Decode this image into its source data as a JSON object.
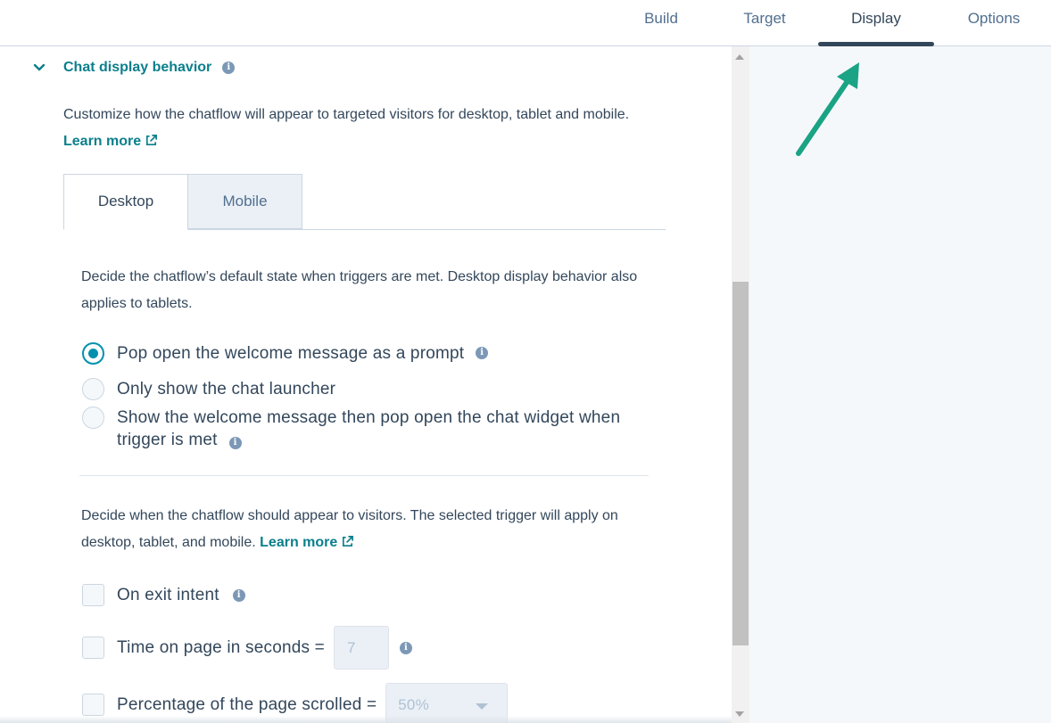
{
  "top_nav": {
    "tabs": [
      {
        "label": "Build"
      },
      {
        "label": "Target"
      },
      {
        "label": "Display"
      },
      {
        "label": "Options"
      }
    ]
  },
  "section": {
    "title": "Chat display behavior",
    "description": "Customize how the chatflow will appear to targeted visitors for desktop, tablet and mobile.",
    "learn_more": "Learn more"
  },
  "device_tabs": {
    "desktop": "Desktop",
    "mobile": "Mobile"
  },
  "default_state": {
    "description": "Decide the chatflow’s default state when triggers are met. Desktop display behavior also applies to tablets.",
    "options": [
      {
        "label": "Pop open the welcome message as a prompt",
        "checked": true
      },
      {
        "label": "Only show the chat launcher",
        "checked": false
      },
      {
        "label": "Show the welcome message then pop open the chat widget when trigger is met",
        "checked": false
      }
    ]
  },
  "triggers": {
    "description": "Decide when the chatflow should appear to visitors. The selected trigger will apply on desktop, tablet, and mobile.",
    "learn_more": "Learn more",
    "exit_intent_label": "On exit intent",
    "time_on_page_label": "Time on page in seconds =",
    "time_on_page_value": "7",
    "scroll_label": "Percentage of the page scrolled =",
    "scroll_value": "50%"
  },
  "colors": {
    "accent": "#0b7f8c",
    "radio_selected": "#0091ae",
    "annotation_arrow": "#1aa385"
  }
}
